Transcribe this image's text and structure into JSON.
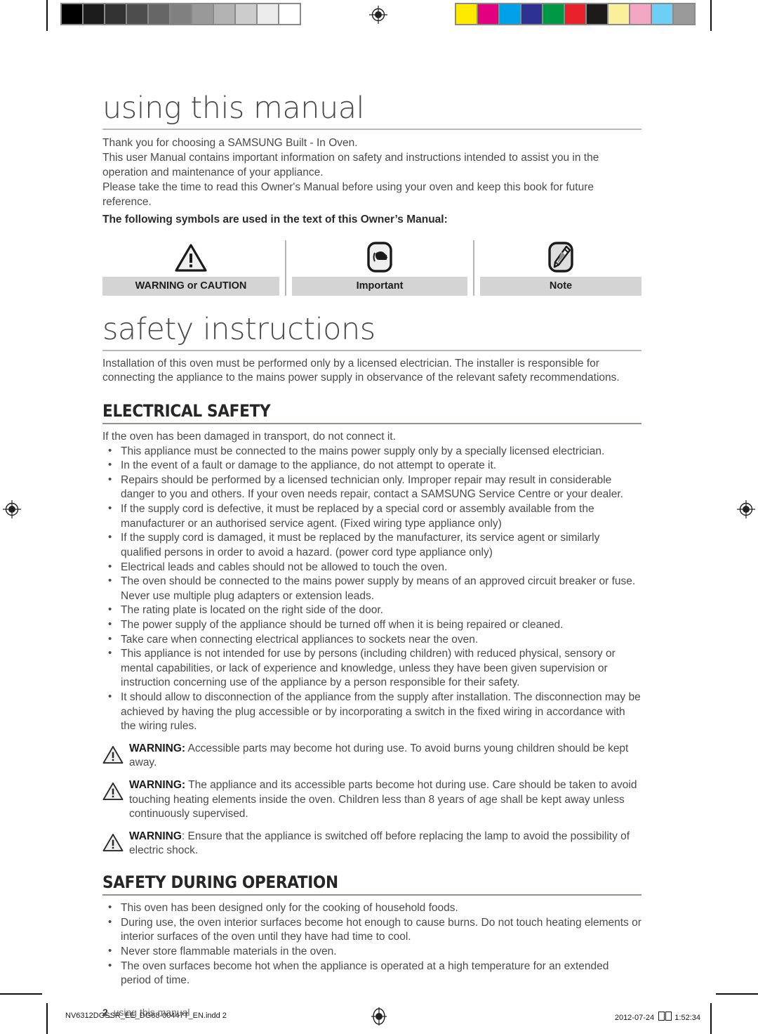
{
  "calibration": {
    "gray_wedge": [
      "#000000",
      "#1c1c1c",
      "#333333",
      "#4d4d4d",
      "#666666",
      "#808080",
      "#999999",
      "#b3b3b3",
      "#cccccc",
      "#ebebeb",
      "#ffffff"
    ],
    "color_wedge": [
      "#fdea00",
      "#e3007f",
      "#00a0e9",
      "#2e3192",
      "#009844",
      "#e8212a",
      "#1d1a1a",
      "#faef9b",
      "#f4a7c3",
      "#6dcff6",
      "#9a9a9a"
    ],
    "registration_mark": "registration-target"
  },
  "header": {
    "title": "using this manual"
  },
  "intro": {
    "lines": [
      "Thank you for choosing a SAMSUNG Built - In Oven.",
      "This user Manual contains important information on safety and instructions intended to assist you in the operation and maintenance of your appliance.",
      "Please take the time to read this Owner's Manual before using your oven and keep this book for future reference."
    ],
    "symbols_lead": "The following symbols are used in the text of this Owner’s Manual:"
  },
  "legend": {
    "items": [
      {
        "icon": "warning-triangle-icon",
        "label": "WARNING or CAUTION"
      },
      {
        "icon": "pointing-hand-icon",
        "label": "Important"
      },
      {
        "icon": "pencil-note-icon",
        "label": "Note"
      }
    ]
  },
  "safety": {
    "title": "safety instructions",
    "intro": "Installation of this oven must be performed only by a licensed electrician. The installer is responsible for connecting the appliance to the mains power supply in observance of the relevant safety recommendations.",
    "electrical": {
      "heading": "ELECTRICAL SAFETY",
      "lead": "If the oven has been damaged in transport, do not connect it.",
      "bullets": [
        "This appliance must be connected to the mains power supply only by a specially licensed electrician.",
        "In the event of a fault or damage to the appliance, do not attempt to operate it.",
        "Repairs should be performed by a licensed technician only. Improper repair may result in considerable danger to you and others. If your oven needs repair, contact a SAMSUNG Service Centre or your dealer.",
        "If the supply cord is defective, it must be replaced by a special cord or assembly available from the manufacturer or an authorised service agent. (Fixed wiring type appliance only)",
        "If the supply cord is damaged, it must be replaced by the manufacturer, its service agent or similarly qualified persons in order to avoid a hazard. (power cord type appliance only)",
        "Electrical leads and cables should not be allowed to touch the oven.",
        "The oven should be connected to the mains power supply by means of an approved circuit breaker or fuse. Never use multiple plug adapters or extension leads.",
        "The rating plate is located on the right side of the door.",
        "The power supply of the appliance should be turned off when it is being repaired or cleaned.",
        "Take care when connecting electrical appliances to sockets near the oven.",
        "This appliance is not intended for use by persons (including children) with reduced physical, sensory or mental capabilities, or lack of experience and knowledge, unless they have been given supervision or instruction concerning use of the appliance by a person responsible for their safety.",
        "It should allow to disconnection of the appliance from the supply after installation. The disconnection may be achieved by having the plug accessible or by incorporating a switch in the fixed wiring in accordance with the wiring rules."
      ],
      "warnings": [
        {
          "label": "WARNING:",
          "text": " Accessible parts may become hot during use. To avoid burns young children should be kept away."
        },
        {
          "label": "WARNING:",
          "text": " The appliance and its accessible parts become hot during use. Care should be taken to avoid touching heating elements inside the oven. Children less than 8 years of age shall be kept away unless continuously supervised."
        },
        {
          "label": "WARNING",
          "text": ": Ensure that the appliance is switched off before replacing the lamp to avoid the possibility of electric shock."
        }
      ]
    },
    "operation": {
      "heading": "SAFETY DURING OPERATION",
      "bullets": [
        "This oven has been designed only for the cooking of household foods.",
        "During use, the oven interior surfaces become hot enough to cause burns. Do not touch heating elements or interior surfaces of the oven until they have had time to cool.",
        "Never store flammable materials in the oven.",
        "The oven surfaces become hot when the appliance is operated at a high temperature for an extended period of time."
      ]
    }
  },
  "page_footer": {
    "number": "2",
    "label": "_using this manual"
  },
  "print_slug": {
    "filename": "NV6312DGSSR_EE_DG68-00447T_EN.indd   2",
    "date": "2012-07-24",
    "time": "1:52:34"
  }
}
